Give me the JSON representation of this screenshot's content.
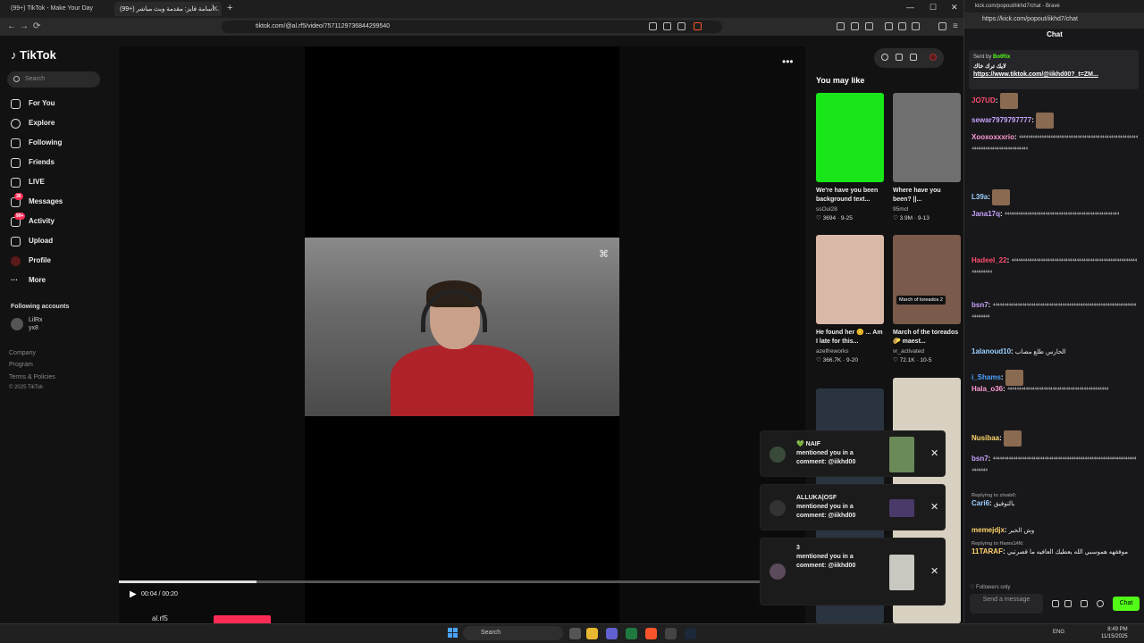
{
  "browser": {
    "tabs": [
      {
        "label": "(99+) TikTok - Make Your Day"
      },
      {
        "label": "(99+) أسامة فايز: مقدمة وبث مباشر..."
      }
    ],
    "url": "tiktok.com/@al.rf5/video/7571129736844299540"
  },
  "tiktok": {
    "logo": "TikTok",
    "search_placeholder": "Search",
    "nav": [
      {
        "label": "For You",
        "icon": "home-icon"
      },
      {
        "label": "Explore",
        "icon": "compass-icon"
      },
      {
        "label": "Following",
        "icon": "following-icon"
      },
      {
        "label": "Friends",
        "icon": "friends-icon"
      },
      {
        "label": "LIVE",
        "icon": "live-icon"
      },
      {
        "label": "Messages",
        "icon": "messages-icon",
        "badge": "36"
      },
      {
        "label": "Activity",
        "icon": "activity-icon",
        "badge": "99+"
      },
      {
        "label": "Upload",
        "icon": "upload-icon"
      },
      {
        "label": "Profile",
        "icon": "profile-icon"
      },
      {
        "label": "More",
        "icon": "more-icon"
      }
    ],
    "following_title": "Following accounts",
    "following_account": {
      "name": "LilRx",
      "handle": "yx8"
    },
    "footer": [
      "Company",
      "Program",
      "Terms & Policies",
      "© 2025 TikTok"
    ],
    "video": {
      "time": "00:04 / 00:20",
      "progress": 0.2,
      "author": "al.rf5"
    },
    "you_may_like": "You may like",
    "cards": [
      {
        "title": "We're have you been background text...",
        "user": "ssOul28",
        "likes": "3694",
        "date": "9-25",
        "color": "#19e619"
      },
      {
        "title": "Where have you been? ||...",
        "user": "95mcl",
        "likes": "3.9M",
        "date": "9-13",
        "color": "#6f6f6f"
      },
      {
        "title": "He found her 😊 ... Am I late for this...",
        "user": "azelfreworks",
        "likes": "366.7K",
        "date": "9-20",
        "color": "#d9b8a8"
      },
      {
        "title": "March of the toreados 🌮 maest...",
        "user": "vr_activated",
        "likes": "72.1K",
        "date": "10-5",
        "color": "#7a5a4a",
        "overlay": "March of toreados 2"
      }
    ]
  },
  "notifications": [
    {
      "name": "💚 NAIF",
      "text": "mentioned you in a comment: @iikhd00"
    },
    {
      "name": "ALLUKA|OSF",
      "text": "mentioned you in a comment: @iikhd00"
    },
    {
      "name": "3",
      "text": "mentioned you in a comment: @iikhd00"
    }
  ],
  "chat": {
    "tab": "kick.com/popout/iikhd7/chat - Brave",
    "url": "https://kick.com/popout/iikhd7/chat",
    "title": "Chat",
    "pinned": {
      "sent_by": "Sent by",
      "bot": "BotRix",
      "text": "لايك ترك خاك",
      "link": "https://www.tiktok.com/@iikhd00?_t=ZM..."
    },
    "messages": [
      {
        "user": "JO7UD",
        "color": "#ff4d6d",
        "text": ""
      },
      {
        "user": "sewar7979797777",
        "color": "#c9a3ff",
        "text": ""
      },
      {
        "user": "Xooxoxxxrio",
        "color": "#ff9ad5",
        "text": "⁴⁴⁴⁴⁴⁴⁴⁴⁴⁴⁴⁴⁴⁴⁴⁴⁴⁴⁴⁴⁴⁴⁴⁴⁴⁴⁴⁴⁴⁴⁴⁴⁴⁴⁴⁴⁴⁴⁴⁴⁴⁴⁴⁴⁴⁴⁴⁴⁴⁴⁴⁴⁴⁴⁴⁴⁴⁴⁴⁴⁴⁴⁴⁴⁴⁴⁴⁴⁴⁴⁴⁴⁴⁴⁴⁴⁴⁴"
      },
      {
        "user": "L39a",
        "color": "#9ad0ff",
        "text": ""
      },
      {
        "user": "Jana17q",
        "color": "#c9a3ff",
        "text": "⁴⁴⁴⁴⁴⁴⁴⁴⁴⁴⁴⁴⁴⁴⁴⁴⁴⁴⁴⁴⁴⁴⁴⁴⁴⁴⁴⁴⁴⁴⁴⁴⁴⁴⁴⁴⁴⁴⁴⁴⁴⁴⁴⁴⁴⁴⁴⁴⁴⁴⁴"
      },
      {
        "user": "Hadeel_22",
        "color": "#ff4d6d",
        "text": "⁴⁴⁴⁴⁴⁴⁴⁴⁴⁴⁴⁴⁴⁴⁴⁴⁴⁴⁴⁴⁴⁴⁴⁴⁴⁴⁴⁴⁴⁴⁴⁴⁴⁴⁴⁴⁴⁴⁴⁴⁴⁴⁴⁴⁴⁴⁴⁴⁴⁴⁴⁴⁴⁴⁴⁴⁴⁴⁴⁴⁴⁴⁴⁴⁴"
      },
      {
        "user": "bsn7",
        "color": "#c9a3ff",
        "text": "⁴⁴⁴⁴⁴⁴⁴⁴⁴⁴⁴⁴⁴⁴⁴⁴⁴⁴⁴⁴⁴⁴⁴⁴⁴⁴⁴⁴⁴⁴⁴⁴⁴⁴⁴⁴⁴⁴⁴⁴⁴⁴⁴⁴⁴⁴⁴⁴⁴⁴⁴⁴⁴⁴⁴⁴⁴⁴⁴⁴⁴⁴⁴⁴⁴⁴⁴⁴⁴⁴⁴⁴"
      },
      {
        "user": "1alanoud10",
        "color": "#9ad0ff",
        "text": "الحارس طلع مصاب"
      },
      {
        "user": "i_Shams",
        "color": "#4da3ff",
        "text": ""
      },
      {
        "user": "Hala_o36",
        "color": "#ff9ad5",
        "text": "⁴⁴⁴⁴⁴⁴⁴⁴⁴⁴⁴⁴⁴⁴⁴⁴⁴⁴⁴⁴⁴⁴⁴⁴⁴⁴⁴⁴⁴⁴⁴⁴⁴⁴⁴⁴⁴⁴⁴⁴⁴⁴⁴⁴⁴"
      },
      {
        "user": "Nusibaa",
        "color": "#ffd36b",
        "text": ""
      },
      {
        "user": "bsn7",
        "color": "#c9a3ff",
        "text": "⁴⁴⁴⁴⁴⁴⁴⁴⁴⁴⁴⁴⁴⁴⁴⁴⁴⁴⁴⁴⁴⁴⁴⁴⁴⁴⁴⁴⁴⁴⁴⁴⁴⁴⁴⁴⁴⁴⁴⁴⁴⁴⁴⁴⁴⁴⁴⁴⁴⁴⁴⁴⁴⁴⁴⁴⁴⁴⁴⁴⁴⁴⁴⁴⁴⁴⁴⁴⁴⁴⁴"
      },
      {
        "user": "Cari6",
        "color": "#9ad0ff",
        "text": "بالتوفيق",
        "reply": "Replying to zinab0:"
      },
      {
        "user": "memejdjx",
        "color": "#ffd36b",
        "text": "وش الخبر"
      },
      {
        "user": "11TARAF",
        "color": "#ffd36b",
        "text": "موفقهه هموسبي الله يعطيك العافيه ما قصرتيي",
        "reply": "Replying to Hams14N:"
      }
    ],
    "followers_only": "Followers only",
    "send_placeholder": "Send a message",
    "send_button": "Chat"
  },
  "taskbar": {
    "search": "Search",
    "lang": "ENG",
    "time": "8:49 PM",
    "date": "11/15/2025"
  }
}
